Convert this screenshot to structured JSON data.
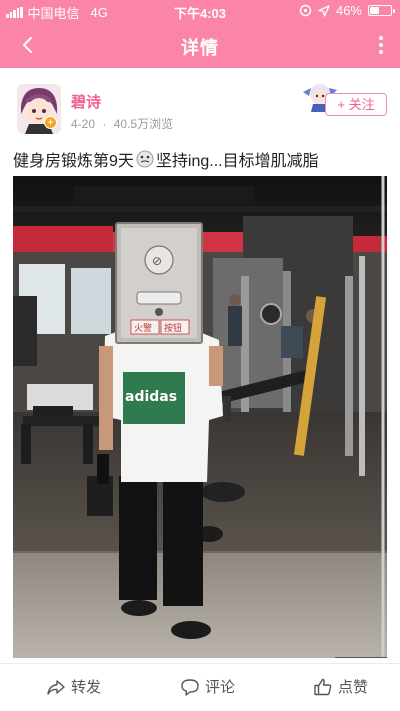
{
  "status_bar": {
    "carrier": "中国电信",
    "network": "4G",
    "time": "下午4:03",
    "battery_percent": "46%",
    "battery_level": 0.46
  },
  "header": {
    "title": "详情",
    "background": "#fb85a6"
  },
  "post": {
    "author": "碧诗",
    "date": "4-20",
    "views": "40.5万浏览",
    "follow_label": "+ 关注",
    "title_part1": "健身房锻炼第9天",
    "title_part2": "坚持ing...目标增肌减脂",
    "photo_labels": {
      "shirt_brand": "adidas",
      "box_left_label": "火警",
      "box_right_label": "按钮"
    }
  },
  "actions": {
    "share": "转发",
    "comment": "评论",
    "like": "点赞"
  },
  "icons": [
    "back-icon",
    "more-icon",
    "signal-icon",
    "location-icon",
    "alarm-icon",
    "battery-icon",
    "share-icon",
    "comment-icon",
    "like-icon",
    "emoji-icon"
  ],
  "colors": {
    "accent": "#fb85a6",
    "username": "#f06292",
    "meta": "#9b9b9b"
  }
}
